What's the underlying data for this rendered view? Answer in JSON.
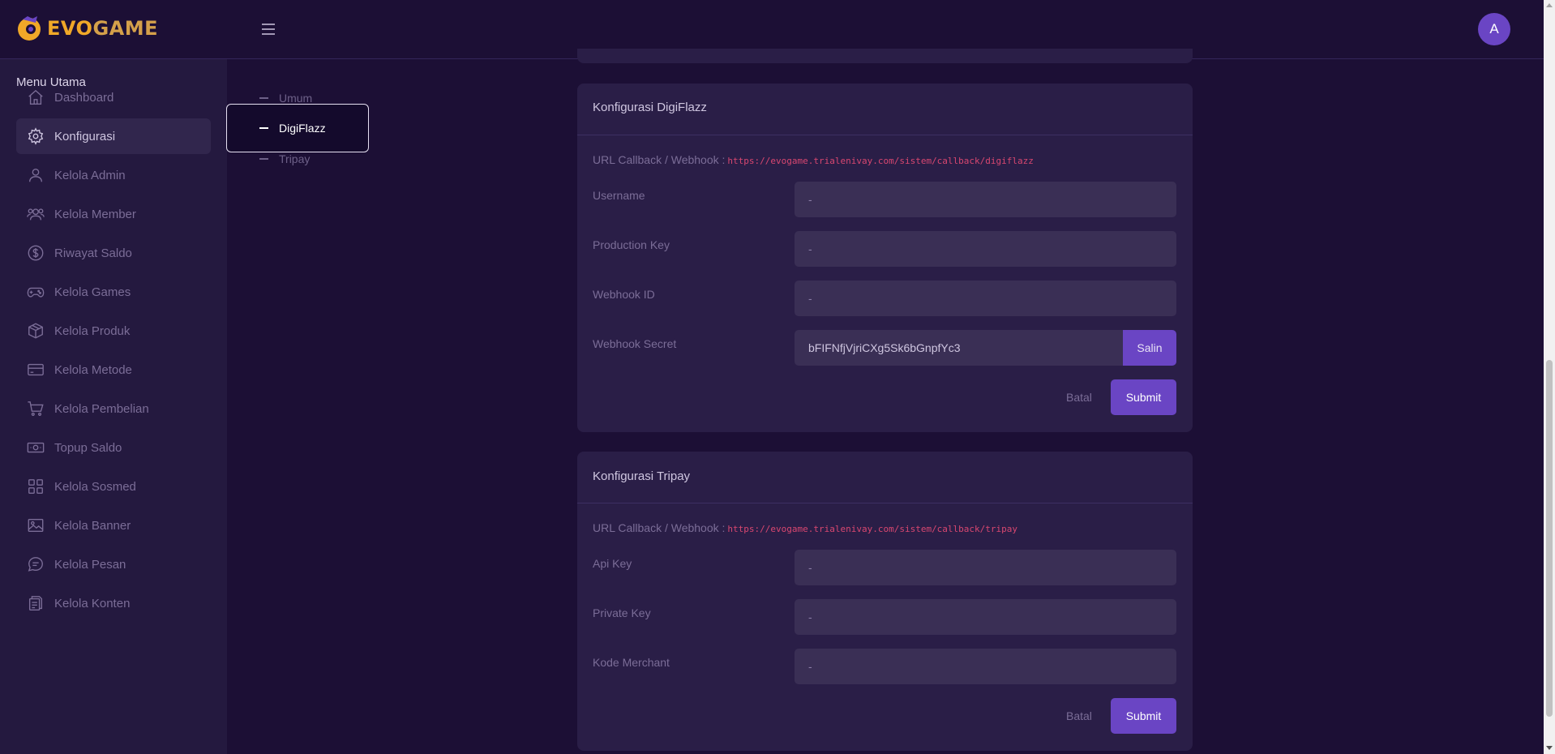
{
  "app": {
    "logo_part1": "EVO",
    "logo_part2": "GAME",
    "avatar_initial": "A"
  },
  "sidebar": {
    "heading": "Menu Utama",
    "items": [
      {
        "label": "Dashboard",
        "icon": "home-icon"
      },
      {
        "label": "Konfigurasi",
        "icon": "gear-icon",
        "active": true
      },
      {
        "label": "Kelola Admin",
        "icon": "user-icon"
      },
      {
        "label": "Kelola Member",
        "icon": "users-icon"
      },
      {
        "label": "Riwayat Saldo",
        "icon": "dollar-circle-icon"
      },
      {
        "label": "Kelola Games",
        "icon": "gamepad-icon"
      },
      {
        "label": "Kelola Produk",
        "icon": "box-icon"
      },
      {
        "label": "Kelola Metode",
        "icon": "credit-card-icon"
      },
      {
        "label": "Kelola Pembelian",
        "icon": "cart-icon"
      },
      {
        "label": "Topup Saldo",
        "icon": "banknote-icon"
      },
      {
        "label": "Kelola Sosmed",
        "icon": "grid-icon"
      },
      {
        "label": "Kelola Banner",
        "icon": "image-icon"
      },
      {
        "label": "Kelola Pesan",
        "icon": "message-icon"
      },
      {
        "label": "Kelola Konten",
        "icon": "document-icon"
      }
    ]
  },
  "subnav": {
    "items": [
      "Umum",
      "DigiFlazz",
      "Tripay"
    ],
    "active": "DigiFlazz"
  },
  "digiflazz": {
    "title": "Konfigurasi DigiFlazz",
    "url_label": "URL Callback / Webhook :",
    "url_value": "https://evogame.trialenivay.com/sistem/callback/digiflazz",
    "fields": [
      {
        "label": "Username",
        "value": "-"
      },
      {
        "label": "Production Key",
        "value": "-"
      },
      {
        "label": "Webhook ID",
        "value": "-"
      },
      {
        "label": "Webhook Secret",
        "value": "bFIFNfjVjriCXg5Sk6bGnpfYc3"
      }
    ],
    "copy_label": "Salin",
    "cancel_label": "Batal",
    "submit_label": "Submit"
  },
  "tripay": {
    "title": "Konfigurasi Tripay",
    "url_label": "URL Callback / Webhook :",
    "url_value": "https://evogame.trialenivay.com/sistem/callback/tripay",
    "fields": [
      {
        "label": "Api Key",
        "value": "-"
      },
      {
        "label": "Private Key",
        "value": "-"
      },
      {
        "label": "Kode Merchant",
        "value": "-"
      }
    ],
    "cancel_label": "Batal",
    "submit_label": "Submit"
  },
  "colors": {
    "background": "#1c0f35",
    "sidebar": "#24193f",
    "card": "#2a1e47",
    "accent": "#6a45c4",
    "url": "#d94770",
    "logo": "#f0a828"
  }
}
